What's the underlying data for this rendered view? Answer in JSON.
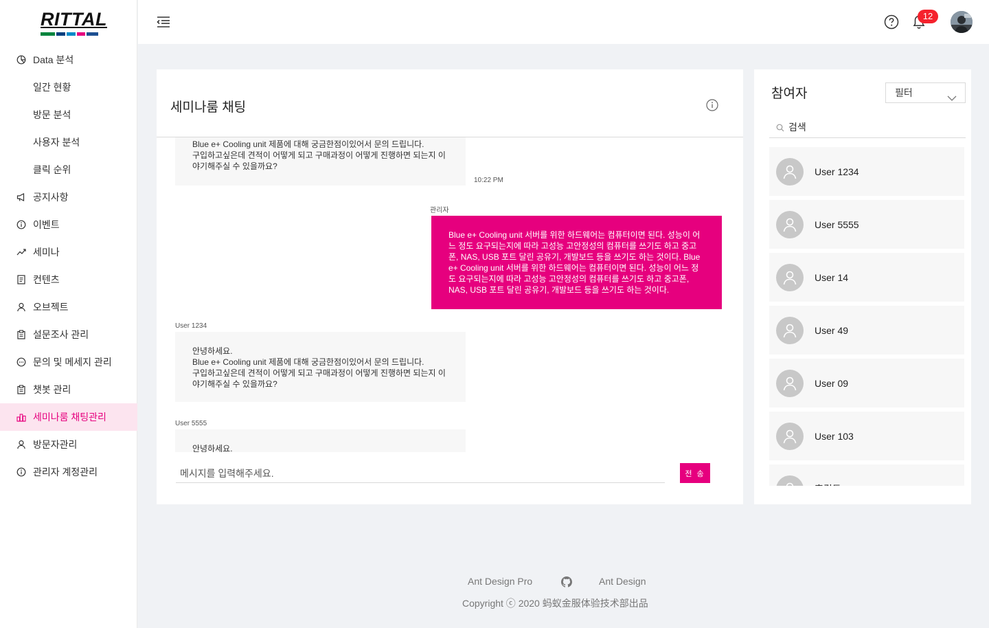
{
  "brand": {
    "logo_text": "RITTAL",
    "bar_colors": [
      "#00843d",
      "#003e7e",
      "#0089c8",
      "#e6007e",
      "#1d4f91"
    ]
  },
  "sidebar": {
    "items": [
      {
        "label": "Data 분석",
        "icon": "pie-chart-icon",
        "sub": false
      },
      {
        "label": "일간 현황",
        "icon": "",
        "sub": true
      },
      {
        "label": "방문 분석",
        "icon": "",
        "sub": true
      },
      {
        "label": "사용자 분석",
        "icon": "",
        "sub": true
      },
      {
        "label": "클릭 순위",
        "icon": "",
        "sub": true
      },
      {
        "label": "공지사항",
        "icon": "megaphone-icon",
        "sub": false
      },
      {
        "label": "이벤트",
        "icon": "info-circle-icon",
        "sub": false
      },
      {
        "label": "세미나",
        "icon": "line-chart-icon",
        "sub": false
      },
      {
        "label": "컨텐츠",
        "icon": "file-text-icon",
        "sub": false
      },
      {
        "label": "오브젝트",
        "icon": "user-icon",
        "sub": false
      },
      {
        "label": "설문조사 관리",
        "icon": "clipboard-icon",
        "sub": false
      },
      {
        "label": "문의 및 메세지 관리",
        "icon": "message-icon",
        "sub": false
      },
      {
        "label": "챗봇 관리",
        "icon": "clipboard-icon",
        "sub": false
      },
      {
        "label": "세미나룸 채팅관리",
        "icon": "team-icon",
        "sub": false,
        "active": true
      },
      {
        "label": "방문자관리",
        "icon": "user-icon",
        "sub": false
      },
      {
        "label": "관리자 계정관리",
        "icon": "info-circle-icon",
        "sub": false
      }
    ]
  },
  "header": {
    "notification_count": "12",
    "accent_color": "#e6007e"
  },
  "chat": {
    "title": "세미나룸 채팅",
    "messages": [
      {
        "sender": "",
        "side": "left",
        "lines": [
          "Blue e+ Cooling unit 제품에 대해 궁금한점이있어서 문의 드립니다.",
          "구입하고싶은데 견적이 어떻게 되고 구매과정이 어떻게 진행하면 되는지 이",
          "야기해주실 수 있을까요?"
        ],
        "time": "10:22 PM"
      },
      {
        "sender": "관리자",
        "side": "right",
        "lines": [
          "Blue e+ Cooling unit 서버를 위한 하드웨어는 컴퓨터이면 된다. 성능이 어",
          "느 정도 요구되는지에 따라 고성능 고안정성의 컴퓨터를 쓰기도 하고 중고",
          "폰, NAS, USB 포트 달린 공유기, 개발보드 등을 쓰기도 하는 것이다. Blue",
          "e+ Cooling unit 서버를 위한 하드웨어는 컴퓨터이면 된다. 성능이 어느 정",
          "도 요구되는지에 따라 고성능 고안정성의 컴퓨터를 쓰기도 하고 중고폰,",
          "NAS, USB 포트 달린 공유기, 개발보드 등을 쓰기도 하는 것이다."
        ]
      },
      {
        "sender": "User 1234",
        "side": "left",
        "lines": [
          "안녕하세요.",
          "Blue e+ Cooling unit 제품에 대해 궁금한점이있어서 문의 드립니다.",
          "구입하고싶은데 견적이 어떻게 되고 구매과정이 어떻게 진행하면 되는지 이",
          "야기해주실 수 있을까요?"
        ]
      },
      {
        "sender": "User 5555",
        "side": "left",
        "lines": [
          "안녕하세요."
        ]
      }
    ],
    "input_placeholder": "메시지를 입력해주세요.",
    "send_label": "전 송"
  },
  "participants": {
    "title": "참여자",
    "filter_label": "필터",
    "search_placeholder": "검색",
    "users": [
      "User 1234",
      "User 5555",
      "User 14",
      "User 49",
      "User 09",
      "User 103",
      "홍길동"
    ]
  },
  "footer": {
    "link1": "Ant Design Pro",
    "link2": "Ant Design",
    "copyright": "Copyright ⓒ 2020 蚂蚁金服体验技术部出品"
  }
}
